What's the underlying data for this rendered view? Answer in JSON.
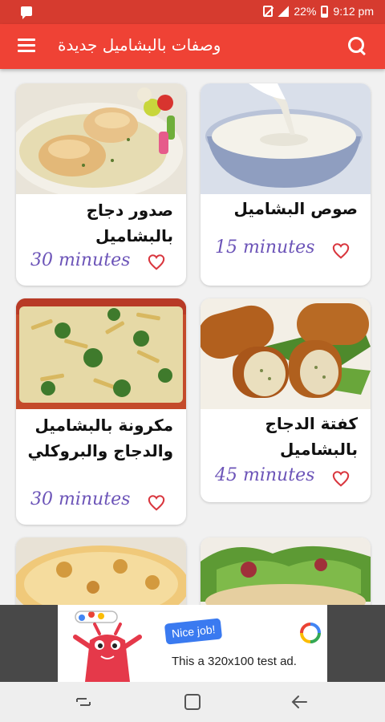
{
  "status_bar": {
    "battery_percent": "22%",
    "time": "9:12 pm"
  },
  "app_bar": {
    "title": "وصفات بالبشاميل جديدة",
    "menu_icon": "hamburger-menu-icon",
    "search_icon": "search-icon"
  },
  "recipes": [
    {
      "title": "صدور دجاج بالبشاميل",
      "time": "30 minutes"
    },
    {
      "title": "صوص البشاميل",
      "time": "15 minutes"
    },
    {
      "title": "مكرونة بالبشاميل والدجاج والبروكلي",
      "time": "30 minutes"
    },
    {
      "title": "كفتة الدجاج بالبشاميل",
      "time": "45 minutes"
    },
    {
      "title": "",
      "time": ""
    },
    {
      "title": "",
      "time": ""
    }
  ],
  "ad": {
    "badge": "Nice job!",
    "text": "This a 320x100 test ad."
  },
  "colors": {
    "primary": "#ef4235",
    "status_bar": "#d63b2f",
    "time_text": "#6c54b8",
    "heart": "#d9363e"
  }
}
